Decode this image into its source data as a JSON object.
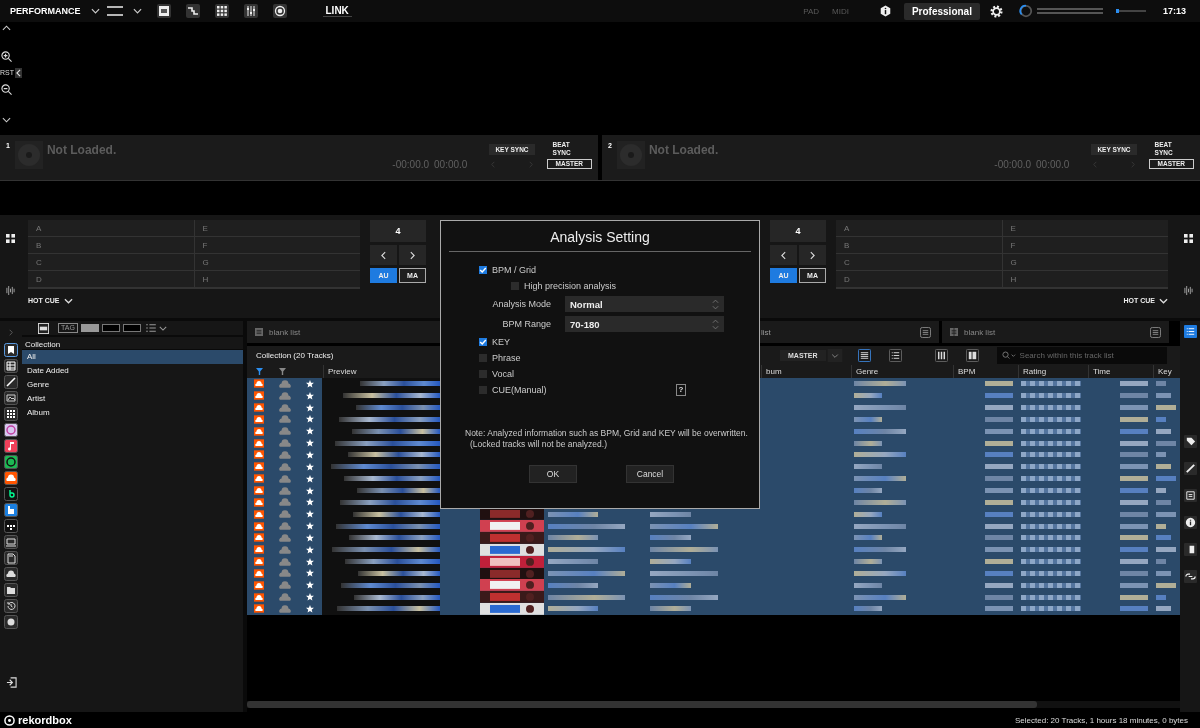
{
  "topbar": {
    "mode": "PERFORMANCE",
    "link": "LINK",
    "controllers": [
      {
        "label": "PAD",
        "disabled": true
      },
      {
        "label": "MIDI",
        "disabled": true
      }
    ],
    "plan": "Professional",
    "volume": {
      "level": 0.1
    },
    "clock": "17:13"
  },
  "waveform_tools": {
    "reset": "RST"
  },
  "decks": [
    {
      "number": "1",
      "status": "Not Loaded.",
      "remaining": "-00:00.0",
      "elapsed": "00:00.0",
      "key_sync": "KEY SYNC",
      "beat_sync": "BEAT SYNC",
      "master": "MASTER"
    },
    {
      "number": "2",
      "status": "Not Loaded.",
      "remaining": "-00:00.0",
      "elapsed": "00:00.0",
      "key_sync": "KEY SYNC",
      "beat_sync": "BEAT SYNC",
      "master": "MASTER"
    }
  ],
  "pad_banks": [
    {
      "pads": [
        "A",
        "E",
        "B",
        "F",
        "C",
        "G",
        "D",
        "H"
      ],
      "quantize": "4",
      "modes": [
        {
          "label": "AU",
          "selected": true
        },
        {
          "label": "MA",
          "selected": false
        }
      ],
      "pad_mode": "HOT CUE"
    },
    {
      "pads": [
        "A",
        "E",
        "B",
        "F",
        "C",
        "G",
        "D",
        "H"
      ],
      "quantize": "4",
      "modes": [
        {
          "label": "AU",
          "selected": true
        },
        {
          "label": "MA",
          "selected": false
        }
      ],
      "pad_mode": "HOT CUE"
    }
  ],
  "library": {
    "source_buttons": [
      {
        "selected": true
      },
      {
        "selected": false
      },
      {
        "selected": false
      },
      {
        "selected": false
      },
      {
        "selected": false
      },
      {
        "selected": false
      },
      {
        "selected": false
      },
      {
        "selected": false
      },
      {
        "selected": false
      },
      {
        "selected": false
      },
      {
        "selected": false
      },
      {
        "selected": false
      },
      {
        "selected": false
      },
      {
        "selected": false
      },
      {
        "selected": false
      },
      {
        "selected": false
      },
      {
        "selected": false
      },
      {
        "selected": false
      }
    ],
    "tag_label": "TAG",
    "tree_title": "Collection",
    "tree": [
      {
        "label": "All",
        "selected": true
      },
      {
        "label": "Date Added",
        "selected": false
      },
      {
        "label": "Genre",
        "selected": false
      },
      {
        "label": "Artist",
        "selected": false
      },
      {
        "label": "Album",
        "selected": false
      }
    ],
    "tabs": [
      {
        "label": "blank list"
      },
      {
        "label": "list"
      },
      {
        "label": "blank list"
      }
    ],
    "list_title": "Collection (20 Tracks)",
    "deck_target": "MASTER",
    "search": {
      "placeholder": "Search within this track list"
    },
    "columns": [
      "Preview",
      "bum",
      "Genre",
      "BPM",
      "Rating",
      "Time",
      "Key"
    ],
    "tracks": [
      {
        "selected": true
      },
      {
        "selected": true
      },
      {
        "selected": true
      },
      {
        "selected": true
      },
      {
        "selected": true
      },
      {
        "selected": true
      },
      {
        "selected": true
      },
      {
        "selected": true
      },
      {
        "selected": true
      },
      {
        "selected": true
      },
      {
        "selected": true
      },
      {
        "selected": true
      },
      {
        "selected": true
      },
      {
        "selected": true
      },
      {
        "selected": true
      },
      {
        "selected": true
      },
      {
        "selected": true
      },
      {
        "selected": true
      },
      {
        "selected": true
      },
      {
        "selected": true
      }
    ],
    "side_buttons": [
      {
        "selected": true
      },
      {
        "selected": false
      },
      {
        "selected": false
      },
      {
        "selected": false
      },
      {
        "selected": false
      },
      {
        "selected": false
      },
      {
        "selected": false
      }
    ]
  },
  "dialog": {
    "title": "Analysis Setting",
    "options": [
      {
        "kind": "check",
        "label": "BPM / Grid",
        "checked": true
      },
      {
        "kind": "subcheck",
        "label": "High precision analysis",
        "checked": false
      },
      {
        "kind": "select",
        "label": "Analysis Mode",
        "value": "Normal"
      },
      {
        "kind": "select",
        "label": "BPM Range",
        "value": "70-180"
      },
      {
        "kind": "check",
        "label": "KEY",
        "checked": true
      },
      {
        "kind": "check",
        "label": "Phrase",
        "checked": false
      },
      {
        "kind": "check",
        "label": "Vocal",
        "checked": false
      },
      {
        "kind": "check",
        "label": "CUE(Manual)",
        "checked": false,
        "help": "?"
      }
    ],
    "note": "Note: Analyzed information such as BPM, Grid and KEY will be overwritten.",
    "note_2": "(Locked tracks will not be analyzed.)",
    "buttons": [
      "OK",
      "Cancel"
    ]
  },
  "status": {
    "logo": "rekordbox",
    "summary": "Selected: 20 Tracks, 1 hours 18 minutes, 0 bytes"
  }
}
